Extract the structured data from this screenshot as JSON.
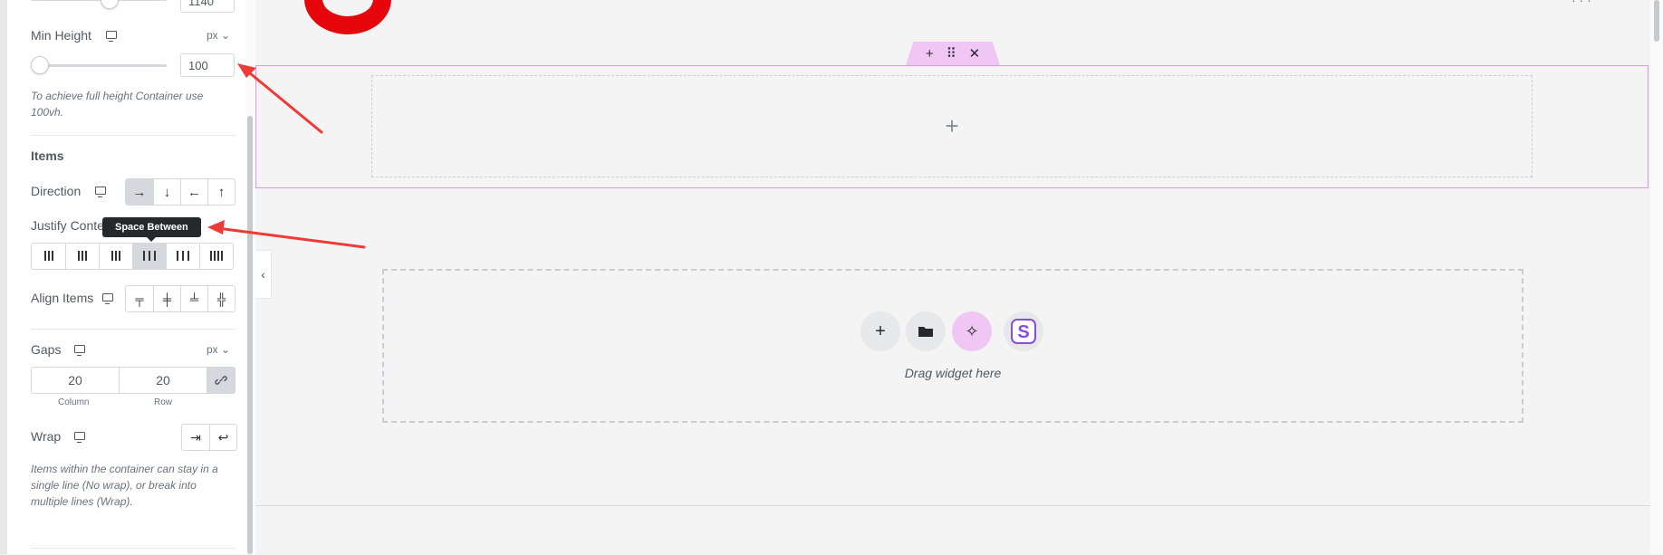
{
  "panel": {
    "max_width_value": "1140",
    "min_height": {
      "label": "Min Height",
      "unit": "px",
      "value": "100",
      "slider_fraction": 0.0,
      "help": [
        "To achieve full height Container use",
        "100vh."
      ]
    },
    "items": {
      "title": "Items",
      "direction_label": "Direction",
      "direction_options": [
        "→",
        "↓",
        "←",
        "↑"
      ],
      "justify_label": "Justify Conte",
      "justify_tooltip": "Space Between",
      "align_label": "Align Items",
      "gaps_label": "Gaps",
      "gaps_unit": "px",
      "gap_column_value": "20",
      "gap_row_value": "20",
      "gap_column_label": "Column",
      "gap_row_label": "Row",
      "wrap_label": "Wrap",
      "wrap_help": [
        "Items within the container can stay in a",
        "single line (No wrap), or break into",
        "multiple lines (Wrap)."
      ]
    }
  },
  "canvas": {
    "collapse_icon": "‹",
    "handle_icons": [
      "+",
      "⠿",
      "✕"
    ],
    "inner_add_icon": "+",
    "drop_text": "Drag widget here"
  },
  "colors": {
    "accent_pink": "#f0c6f4",
    "container_border": "#e98fee",
    "arrow_red": "#ee3b36",
    "logo_red": "#e5050b"
  }
}
